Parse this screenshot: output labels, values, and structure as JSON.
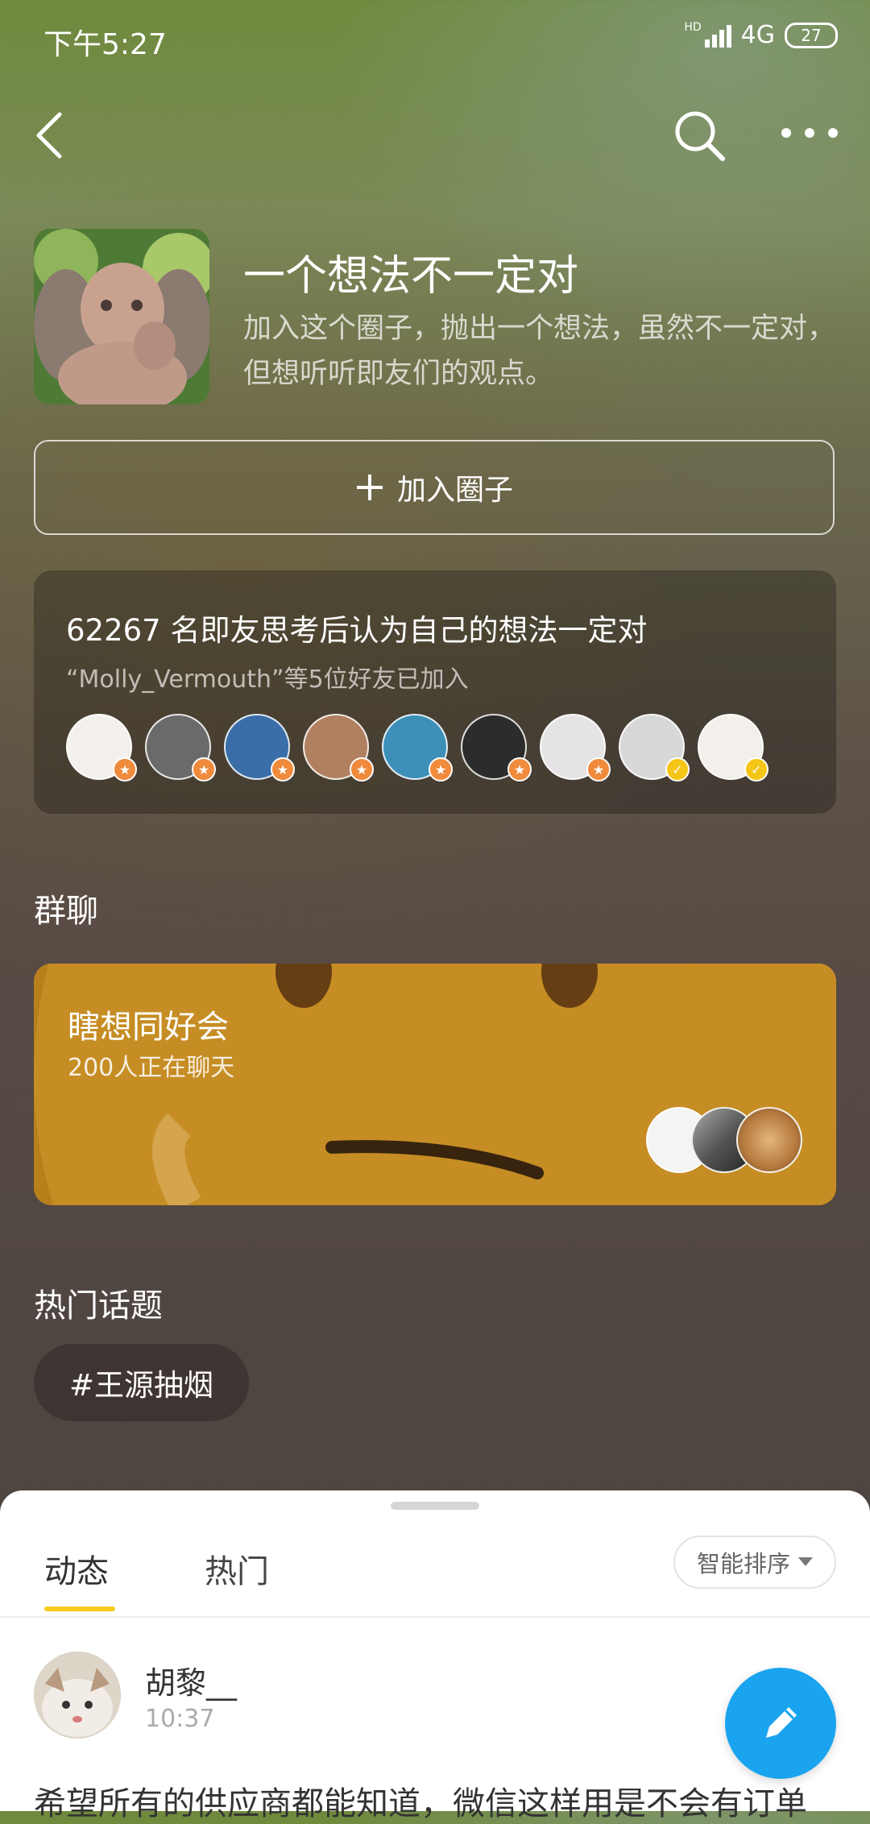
{
  "status_bar": {
    "time": "下午5:27",
    "network": "4G",
    "hd": "HD",
    "battery": "27"
  },
  "nav": {
    "back_icon": "back-arrow-icon",
    "search_icon": "search-icon",
    "more_icon": "more-dots-icon"
  },
  "circle": {
    "title": "一个想法不一定对",
    "description": "加入这个圈子，抛出一个想法，虽然不一定对，但想听听即友们的观点。",
    "join_label": "加入圈子"
  },
  "members": {
    "summary": "62267 名即友思考后认为自己的想法一定对",
    "friends": "“Molly_Vermouth”等5位好友已加入",
    "avatars": [
      {
        "name": "member-avatar-1",
        "color": "#f4f1ec",
        "badge": "orange"
      },
      {
        "name": "member-avatar-2",
        "color": "#6a6a6a",
        "badge": "orange"
      },
      {
        "name": "member-avatar-3",
        "color": "#3a6ea8",
        "badge": "orange"
      },
      {
        "name": "member-avatar-4",
        "color": "#b08060",
        "badge": "orange"
      },
      {
        "name": "member-avatar-5",
        "color": "#3d8fb8",
        "badge": "orange"
      },
      {
        "name": "member-avatar-6",
        "color": "#2c2c2c",
        "badge": "orange"
      },
      {
        "name": "member-avatar-7",
        "color": "#e6e3e6",
        "badge": "orange"
      },
      {
        "name": "member-avatar-8",
        "color": "#d8d8d8",
        "badge": "yellow"
      },
      {
        "name": "member-avatar-9",
        "color": "#f3efea",
        "badge": "yellow"
      }
    ]
  },
  "group_chat": {
    "section_title": "群聊",
    "name": "瞎想同好会",
    "count": "200人正在聊天"
  },
  "topics": {
    "section_title": "热门话题",
    "items": [
      "#王源抽烟"
    ]
  },
  "feed": {
    "tabs": [
      "动态",
      "热门"
    ],
    "sort_label": "智能排序",
    "post": {
      "user": "胡黎__",
      "time": "10:37",
      "text": "希望所有的供应商都能知道，微信这样用是不会有订单"
    }
  },
  "colors": {
    "accent": "#f7cc1c",
    "fab": "#1aa4f0"
  }
}
